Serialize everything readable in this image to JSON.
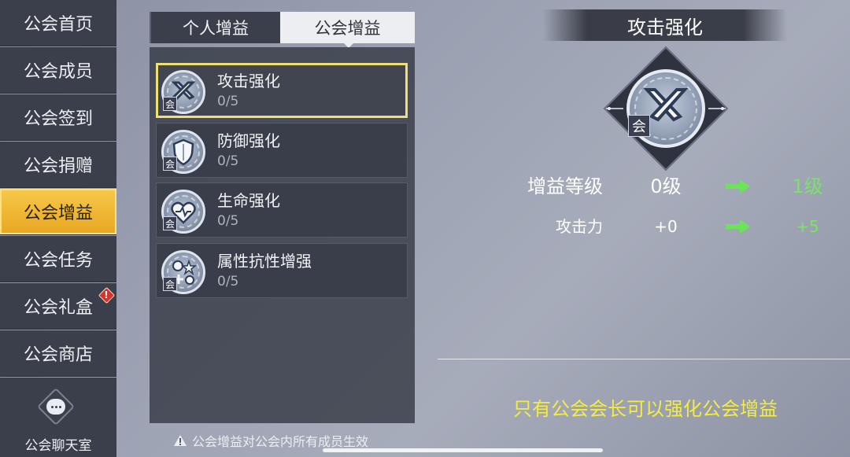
{
  "sidebar": {
    "items": [
      {
        "label": "公会首页",
        "active": false
      },
      {
        "label": "公会成员",
        "active": false
      },
      {
        "label": "公会签到",
        "active": false
      },
      {
        "label": "公会捐赠",
        "active": false
      },
      {
        "label": "公会增益",
        "active": true
      },
      {
        "label": "公会任务",
        "active": false
      },
      {
        "label": "公会礼盒",
        "active": false,
        "badge": "!"
      },
      {
        "label": "公会商店",
        "active": false
      }
    ],
    "chat": {
      "label": "公会聊天室",
      "icon": "chat-bubble-icon"
    }
  },
  "tabs": [
    {
      "label": "个人增益",
      "selected": false
    },
    {
      "label": "公会增益",
      "selected": true
    }
  ],
  "buffs": [
    {
      "name": "攻击强化",
      "level": "0/5",
      "tag": "会",
      "icon": "crossed-swords-icon",
      "selected": true
    },
    {
      "name": "防御强化",
      "level": "0/5",
      "tag": "会",
      "icon": "shield-icon",
      "selected": false
    },
    {
      "name": "生命强化",
      "level": "0/5",
      "tag": "会",
      "icon": "heart-icon",
      "selected": false
    },
    {
      "name": "属性抗性增强",
      "level": "0/5",
      "tag": "会",
      "icon": "elements-icon",
      "selected": false
    }
  ],
  "notice": "公会增益对公会内所有成员生效",
  "detail": {
    "title": "攻击强化",
    "tag": "会",
    "stats": [
      {
        "label": "增益等级",
        "from": "0级",
        "to": "1级"
      },
      {
        "label": "攻击力",
        "from": "+0",
        "to": "+5"
      }
    ],
    "hint": "只有公会会长可以强化公会增益"
  },
  "colors": {
    "active_tab": "#e9a621",
    "upgrade_green": "#7be36a",
    "hint_yellow": "#f4ec43",
    "selected_border": "#f0df74",
    "badge_red": "#d8322f"
  }
}
